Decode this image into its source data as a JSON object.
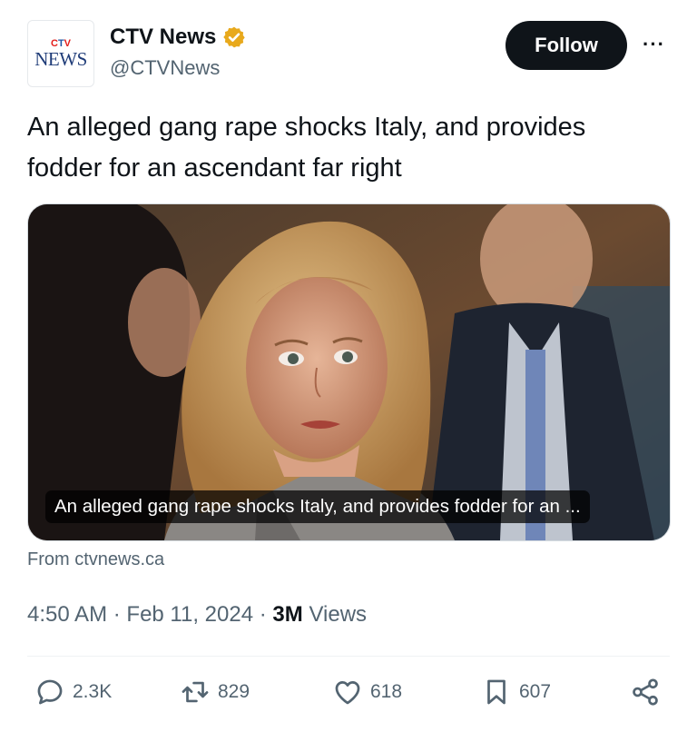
{
  "account": {
    "avatar_top": "CTV",
    "avatar_bottom": "NEWS",
    "name": "CTV News",
    "verified": "verified-badge-icon",
    "handle": "@CTVNews"
  },
  "header": {
    "follow_label": "Follow",
    "more_label": "···"
  },
  "tweet": {
    "text": "An alleged gang rape shocks Italy, and provides fodder for an ascendant far right"
  },
  "card": {
    "title": "An alleged gang rape shocks Italy, and provides fodder for an ...",
    "source": "From ctvnews.ca"
  },
  "meta": {
    "time": "4:50 AM",
    "date": "Feb 11, 2024",
    "views_count": "3M",
    "views_label": "Views",
    "separator": "·"
  },
  "actions": {
    "replies": "2.3K",
    "reposts": "829",
    "likes": "618",
    "bookmarks": "607"
  },
  "colors": {
    "accent": "#0f1419",
    "muted": "#536471",
    "badge": "#e8a91c"
  }
}
